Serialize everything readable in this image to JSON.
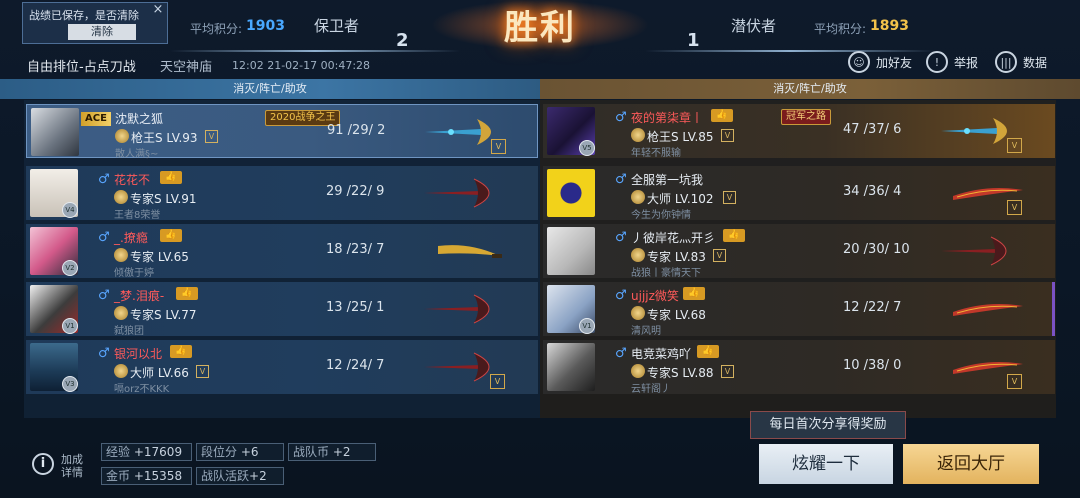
{
  "notice": {
    "text": "战绩已保存，是否清除",
    "clear_label": "清除",
    "close_icon": "×"
  },
  "header": {
    "victory": "胜利",
    "left": {
      "avg_label": "平均积分:",
      "avg_value": "1903",
      "team": "保卫者",
      "score": "2",
      "avg_color": "#49a8ff"
    },
    "right": {
      "avg_label": "平均积分:",
      "avg_value": "1893",
      "team": "潜伏者",
      "score": "1",
      "avg_color": "#f2c24a"
    }
  },
  "match": {
    "mode": "自由排位-占点刀战",
    "map": "天空神庙",
    "time": "12:02   21-02-17 00:47:28"
  },
  "actions": [
    {
      "label": "加好友",
      "icon": "add-friend-icon"
    },
    {
      "label": "举报",
      "icon": "report-icon"
    },
    {
      "label": "数据",
      "icon": "data-icon"
    }
  ],
  "columns": {
    "left": "消灭/阵亡/助攻",
    "right": "消灭/阵亡/助攻"
  },
  "left_players": [
    {
      "name": "沈默之狐",
      "level": "枪王S LV.93",
      "sig": "散人满§~",
      "kda": "91 /29/  2",
      "title": "2020战争之王",
      "ace": "ACE",
      "color": "#e8eef5"
    },
    {
      "name": "花花不",
      "level": "专家S LV.91",
      "sig": "王者8荣誉",
      "kda": "29 /22/  9",
      "color": "#ff5a5a"
    },
    {
      "name": "_.撩瘾",
      "level": "专家 LV.65",
      "sig": "倾傲于婷",
      "kda": "18 /23/  7",
      "color": "#ff5a5a"
    },
    {
      "name": "_梦.泪痕-",
      "level": "专家S LV.77",
      "sig": "弑狼团",
      "kda": "13 /25/  1",
      "color": "#ff5a5a"
    },
    {
      "name": "银河以北",
      "level": "大师 LV.66",
      "sig": "嗝orz不KKK",
      "kda": "12 /24/  7",
      "color": "#ff5a5a"
    }
  ],
  "right_players": [
    {
      "name": "夜的第柒章丨",
      "level": "枪王S LV.85",
      "sig": "年轻不服输",
      "kda": "47 /37/  6",
      "title": "冠军之路",
      "color": "#ff5a5a"
    },
    {
      "name": "全服第一坑我",
      "level": "大师 LV.102",
      "sig": "今生为你钟情",
      "kda": "34 /36/  4",
      "color": "#e8eef5"
    },
    {
      "name": "丿彼岸花灬开彡",
      "level": "专家 LV.83",
      "sig": "战狼丨豪情天下",
      "kda": "20 /30/ 10",
      "color": "#e8eef5"
    },
    {
      "name": "ujjjz微笑",
      "level": "专家 LV.68",
      "sig": "清风明",
      "kda": "12 /22/  7",
      "color": "#ff5a5a"
    },
    {
      "name": "电竞菜鸡吖",
      "level": "专家S LV.88",
      "sig": "云轩阁丿",
      "kda": "10 /38/  0",
      "color": "#e8eef5"
    }
  ],
  "bottom": {
    "info_label": "加成详情",
    "stats": [
      {
        "k": "经验",
        "v": "+17609"
      },
      {
        "k": "段位分",
        "v": "+6"
      },
      {
        "k": "战队币",
        "v": "+2"
      },
      {
        "k": "金币",
        "v": "+15358"
      },
      {
        "k": "战队活跃",
        "v": "+2"
      }
    ],
    "share_tip": "每日首次分享得奖励",
    "share_button": "炫耀一下",
    "back_button": "返回大厅"
  }
}
